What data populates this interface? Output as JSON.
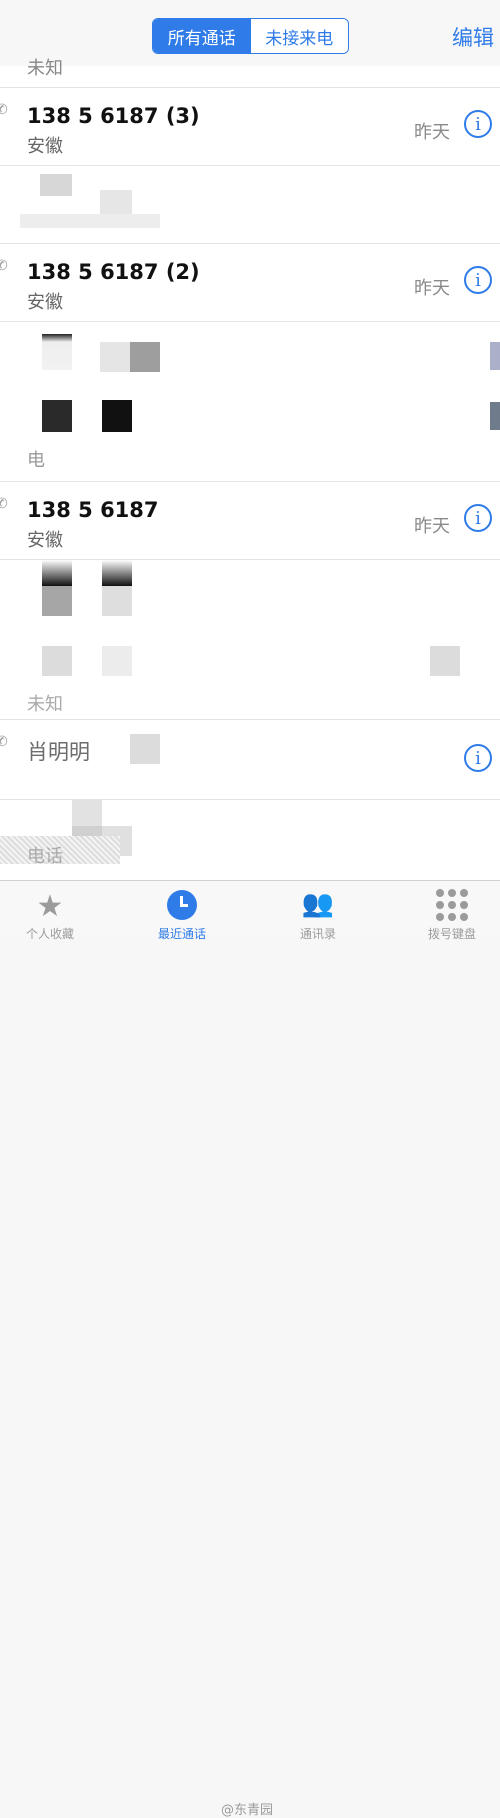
{
  "nav": {
    "segments": [
      "所有通话",
      "未接来电"
    ],
    "edit_label": "编辑"
  },
  "calls": [
    {
      "number": "138 5   6187 (3)",
      "location": "安徽",
      "date": "昨天"
    },
    {
      "number": "138 5   6187 (2)",
      "location": "安徽",
      "date": "昨天"
    },
    {
      "number": "138 5   6187",
      "location": "安徽",
      "date": "昨天"
    }
  ],
  "other_rows": {
    "partial_top": "未知",
    "unknown": "未知",
    "phone_label": "电话",
    "name_partial": "肖明明",
    "electric": "电"
  },
  "tabbar": {
    "favorites": "个人收藏",
    "recents": "最近通话",
    "contacts": "通讯录",
    "keypad": "拨号键盘"
  },
  "watermark": "@东青园"
}
